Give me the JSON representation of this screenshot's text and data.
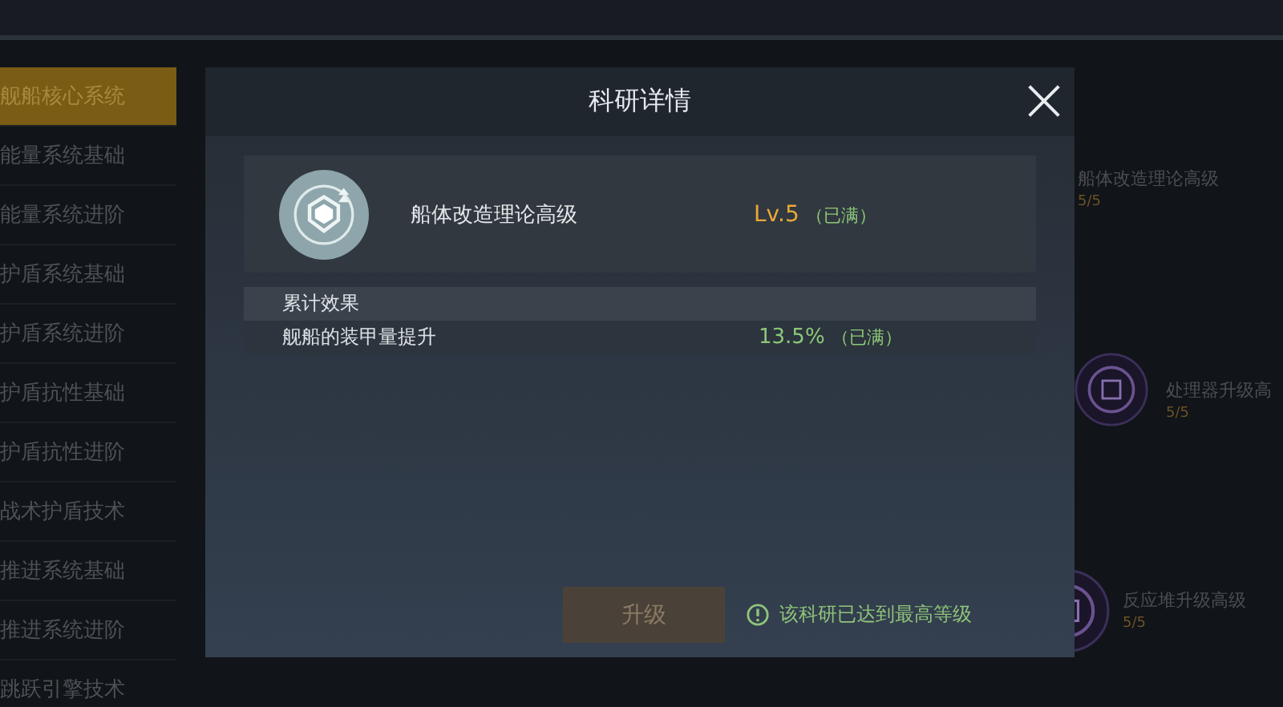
{
  "sidebar": {
    "items": [
      {
        "label": "舰船核心系统",
        "selected": true
      },
      {
        "label": "能量系统基础",
        "selected": false
      },
      {
        "label": "能量系统进阶",
        "selected": false
      },
      {
        "label": "护盾系统基础",
        "selected": false
      },
      {
        "label": "护盾系统进阶",
        "selected": false
      },
      {
        "label": "护盾抗性基础",
        "selected": false
      },
      {
        "label": "护盾抗性进阶",
        "selected": false
      },
      {
        "label": "战术护盾技术",
        "selected": false
      },
      {
        "label": "推进系统基础",
        "selected": false
      },
      {
        "label": "推进系统进阶",
        "selected": false
      },
      {
        "label": "跳跃引擎技术",
        "selected": false
      }
    ]
  },
  "tree_nodes": [
    {
      "name": "船体改造理论高级",
      "progress": "5/5"
    },
    {
      "name": "处理器升级高",
      "progress": "5/5"
    },
    {
      "name": "反应堆升级高级",
      "progress": "5/5"
    }
  ],
  "dialog": {
    "title": "科研详情",
    "research": {
      "name": "船体改造理论高级",
      "level": "Lv.5",
      "level_note": "（已满）"
    },
    "effects": {
      "heading": "累计效果",
      "rows": [
        {
          "label": "舰船的装甲量提升",
          "value": "13.5%",
          "note": "（已满）"
        }
      ]
    },
    "upgrade_button": {
      "label": "升级",
      "disabled": true
    },
    "notice": "该科研已达到最高等级"
  }
}
